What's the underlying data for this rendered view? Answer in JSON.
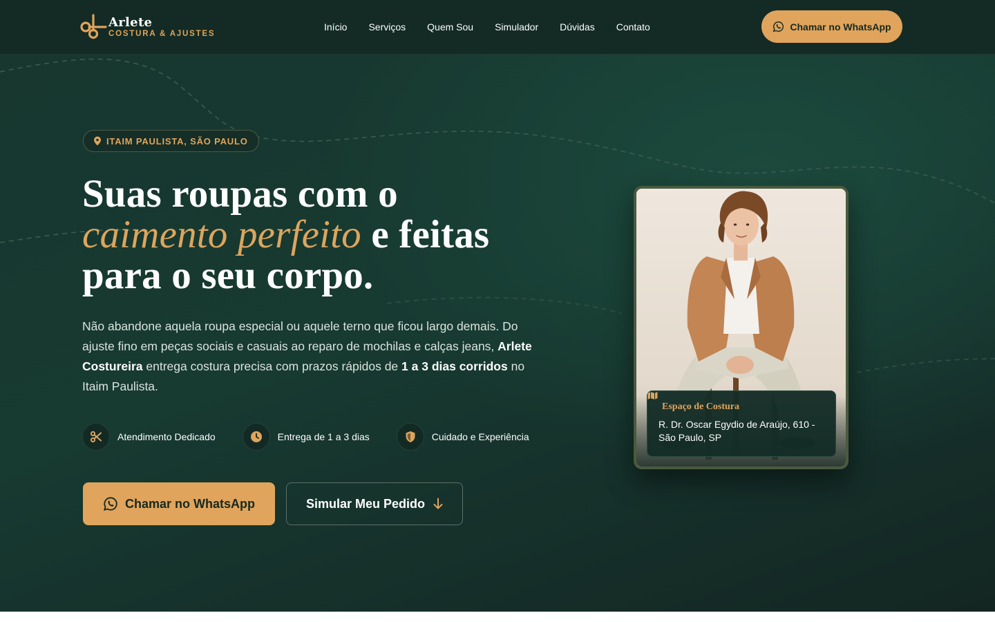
{
  "brand": {
    "name": "Arlete",
    "tagline": "COSTURA & AJUSTES"
  },
  "nav": {
    "items": [
      "Início",
      "Serviços",
      "Quem Sou",
      "Simulador",
      "Dúvidas",
      "Contato"
    ],
    "cta_label": "Chamar no WhatsApp"
  },
  "hero": {
    "location": "ITAIM PAULISTA, SÃO PAULO",
    "headline": {
      "line1": "Suas roupas com o",
      "accent": "caimento perfeito",
      "line2_rest": " e feitas",
      "line3": "para o seu corpo."
    },
    "lead": {
      "part1": "Não abandone aquela roupa especial ou aquele terno que ficou largo demais. Do ajuste fino em peças sociais e casuais ao reparo de mochilas e calças jeans, ",
      "bold1": "Arlete Costureira",
      "part2": " entrega costura precisa com prazos rápidos de ",
      "bold2": "1 a 3 dias corridos",
      "part3": " no Itaim Paulista."
    },
    "features": [
      {
        "icon": "scissors-icon",
        "label": "Atendimento Dedicado"
      },
      {
        "icon": "clock-icon",
        "label": "Entrega de 1 a 3 dias"
      },
      {
        "icon": "shield-icon",
        "label": "Cuidado e Experiência"
      }
    ],
    "primary_button": "Chamar no WhatsApp",
    "secondary_button": "Simular Meu Pedido"
  },
  "card": {
    "title": "Espaço de Costura",
    "address": "R. Dr. Oscar Egydio de Araújo, 610 - São Paulo, SP"
  },
  "colors": {
    "accent": "#e0a45c",
    "background": "#173a31",
    "nav": "#142b25"
  }
}
